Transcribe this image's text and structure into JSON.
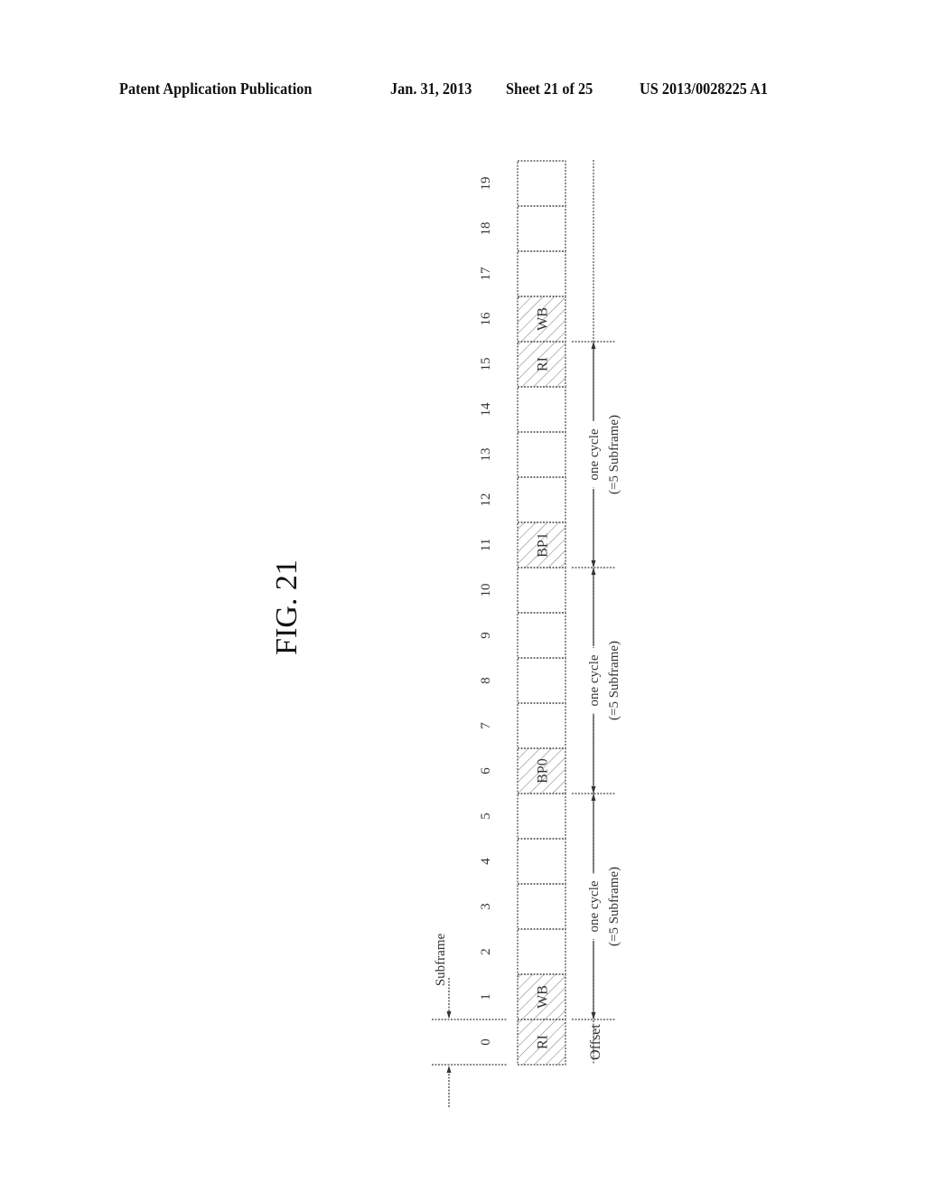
{
  "header": {
    "publication": "Patent Application Publication",
    "date": "Jan. 31, 2013",
    "sheet": "Sheet 21 of 25",
    "number": "US 2013/0028225 A1"
  },
  "figure": {
    "title": "FIG. 21",
    "subframe_label": "Subframe",
    "offset_label": "Offset",
    "subframes": [
      {
        "index": "0",
        "label": "RI",
        "hatched": true
      },
      {
        "index": "1",
        "label": "WB",
        "hatched": true
      },
      {
        "index": "2",
        "label": "",
        "hatched": false
      },
      {
        "index": "3",
        "label": "",
        "hatched": false
      },
      {
        "index": "4",
        "label": "",
        "hatched": false
      },
      {
        "index": "5",
        "label": "",
        "hatched": false
      },
      {
        "index": "6",
        "label": "BP0",
        "hatched": true
      },
      {
        "index": "7",
        "label": "",
        "hatched": false
      },
      {
        "index": "8",
        "label": "",
        "hatched": false
      },
      {
        "index": "9",
        "label": "",
        "hatched": false
      },
      {
        "index": "10",
        "label": "",
        "hatched": false
      },
      {
        "index": "11",
        "label": "BP1",
        "hatched": true
      },
      {
        "index": "12",
        "label": "",
        "hatched": false
      },
      {
        "index": "13",
        "label": "",
        "hatched": false
      },
      {
        "index": "14",
        "label": "",
        "hatched": false
      },
      {
        "index": "15",
        "label": "RI",
        "hatched": true
      },
      {
        "index": "16",
        "label": "WB",
        "hatched": true
      },
      {
        "index": "17",
        "label": "",
        "hatched": false
      },
      {
        "index": "18",
        "label": "",
        "hatched": false
      },
      {
        "index": "19",
        "label": "",
        "hatched": false
      }
    ],
    "cycles": [
      {
        "start": 1,
        "end": 6,
        "line1": "one cycle",
        "line2": "(=5 Subframe)"
      },
      {
        "start": 6,
        "end": 11,
        "line1": "one cycle",
        "line2": "(=5 Subframe)"
      },
      {
        "start": 11,
        "end": 16,
        "line1": "one cycle",
        "line2": "(=5 Subframe)"
      }
    ]
  }
}
